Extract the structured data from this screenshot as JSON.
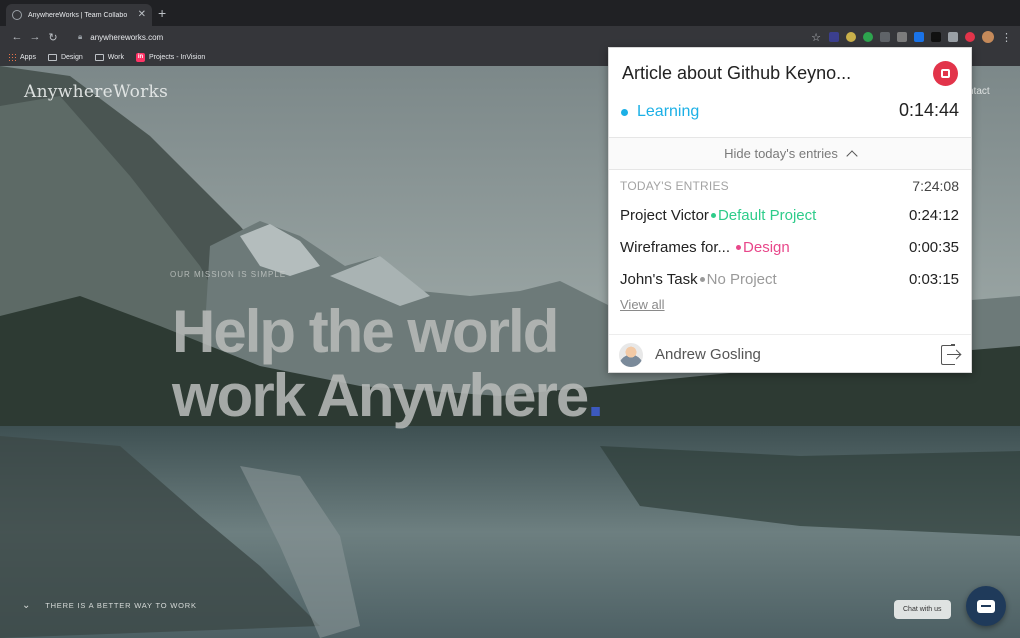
{
  "browser": {
    "tab_title": "AnywhereWorks | Team Collabo",
    "tab_close": "✕",
    "new_tab": "+",
    "url": "anywhereworks.com",
    "bookmarks": [
      {
        "label": "Apps",
        "icon": "apps-grid-icon"
      },
      {
        "label": "Design",
        "icon": "folder-icon"
      },
      {
        "label": "Work",
        "icon": "folder-icon"
      },
      {
        "label": "Projects - InVision",
        "icon": "invision-icon"
      }
    ],
    "extension_colors": [
      "#3b3f8f",
      "#c9b04a",
      "#2da44e",
      "#5f6368",
      "#7c7c7c",
      "#1a73e8",
      "#202124",
      "#9aa0a6",
      "#e2344a"
    ]
  },
  "site": {
    "logo": "AnywhereWorks",
    "nav_contact": "ntact",
    "mission": "OUR MISSION IS SIMPLE",
    "hero_line1": "Help the world",
    "hero_line2": "work Anywhere",
    "hero_dot": ".",
    "scroll_hint": "THERE IS A BETTER WAY TO WORK",
    "chat_label": "Chat with us"
  },
  "timer": {
    "title": "Article about Github Keyno...",
    "project": "Learning",
    "project_color": "#1cb0e6",
    "elapsed": "0:14:44",
    "hide_label": "Hide today's entries",
    "entries_label": "TODAY'S ENTRIES",
    "entries_total": "7:24:08",
    "entries": [
      {
        "description": "Project Victor",
        "project": "Default Project",
        "color": "#2ecc8a",
        "duration": "0:24:12"
      },
      {
        "description": "Wireframes for...",
        "project": "Design",
        "color": "#e8478a",
        "duration": "0:00:35"
      },
      {
        "description": "John's Task",
        "project": "No Project",
        "color": "#9a9a9a",
        "duration": "0:03:15"
      }
    ],
    "view_all": "View all",
    "user": "Andrew Gosling"
  }
}
